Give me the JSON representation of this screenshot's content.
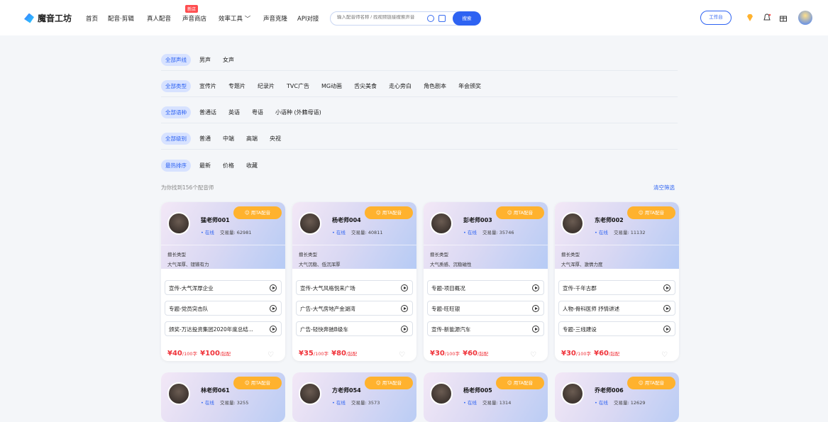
{
  "brand": {
    "name": "魔音工坊"
  },
  "nav": {
    "items": [
      "首页",
      "配音·剪辑",
      "真人配音",
      "声音商店",
      "效率工具 ﹀",
      "声音克隆",
      "API对接"
    ],
    "badge": "新店"
  },
  "search": {
    "placeholder": "输入配音师名称 / 找视频链接搜索声音",
    "button": "搜索"
  },
  "header_right": {
    "workbench": "工作台",
    "icons": [
      "diamond-icon",
      "bell-icon",
      "gift-icon",
      "user-avatar"
    ]
  },
  "filters": [
    {
      "active": "全部声线",
      "options": [
        "男声",
        "女声"
      ]
    },
    {
      "active": "全部类型",
      "options": [
        "宣传片",
        "专题片",
        "纪录片",
        "TVC广告",
        "MG动画",
        "舌尖美食",
        "走心旁白",
        "角色剧本",
        "年会颁奖"
      ]
    },
    {
      "active": "全部语种",
      "options": [
        "普通话",
        "英语",
        "粤语",
        "小语种 (外籍母语)"
      ]
    },
    {
      "active": "全部级别",
      "options": [
        "普通",
        "中端",
        "高端",
        "央视"
      ]
    },
    {
      "active": "最热排序",
      "options": [
        "最新",
        "价格",
        "收藏"
      ]
    }
  ],
  "result": {
    "found": "为你找到156个配音师",
    "clear": "清空筛选"
  },
  "card_labels": {
    "button": "用TA配音",
    "status": "• 在线",
    "volume_prefix": "交易量:",
    "skill_label": "擅长类型",
    "price_unit_a": "/100字",
    "price_unit_b": "/起配"
  },
  "cards": [
    {
      "name": "猛老师001",
      "volume": "62981",
      "skills": "大气浑厚、铿锵有力",
      "samples": [
        "宣传-大气浑厚企业",
        "专题-党员突击队",
        "颁奖-万达投资集团2020年度总结..."
      ],
      "price_a": "¥40",
      "price_b": "¥100"
    },
    {
      "name": "杨老师004",
      "volume": "40811",
      "skills": "大气沉稳、低沉浑厚",
      "samples": [
        "宣传-大气风格悦来广场",
        "广告-大气房地产金湖湾",
        "广告-轻快奔驰B级车"
      ],
      "price_a": "¥35",
      "price_b": "¥80"
    },
    {
      "name": "彭老师003",
      "volume": "35746",
      "skills": "大气质感、沉稳磁性",
      "samples": [
        "专题-项目概况",
        "专题-旺旺银",
        "宣传-新能源汽车"
      ],
      "price_a": "¥30",
      "price_b": "¥60"
    },
    {
      "name": "东老师002",
      "volume": "11132",
      "skills": "大气浑厚、激情力度",
      "samples": [
        "宣传-千年古郡",
        "人物-骨科医师 抒情讲述",
        "专题-三线建设"
      ],
      "price_a": "¥30",
      "price_b": "¥60"
    }
  ],
  "cards_row2": [
    {
      "name": "林老师061",
      "volume": "3255"
    },
    {
      "name": "方老师054",
      "volume": "3573"
    },
    {
      "name": "杨老师005",
      "volume": "1314"
    },
    {
      "name": "乔老师006",
      "volume": "12629"
    }
  ]
}
